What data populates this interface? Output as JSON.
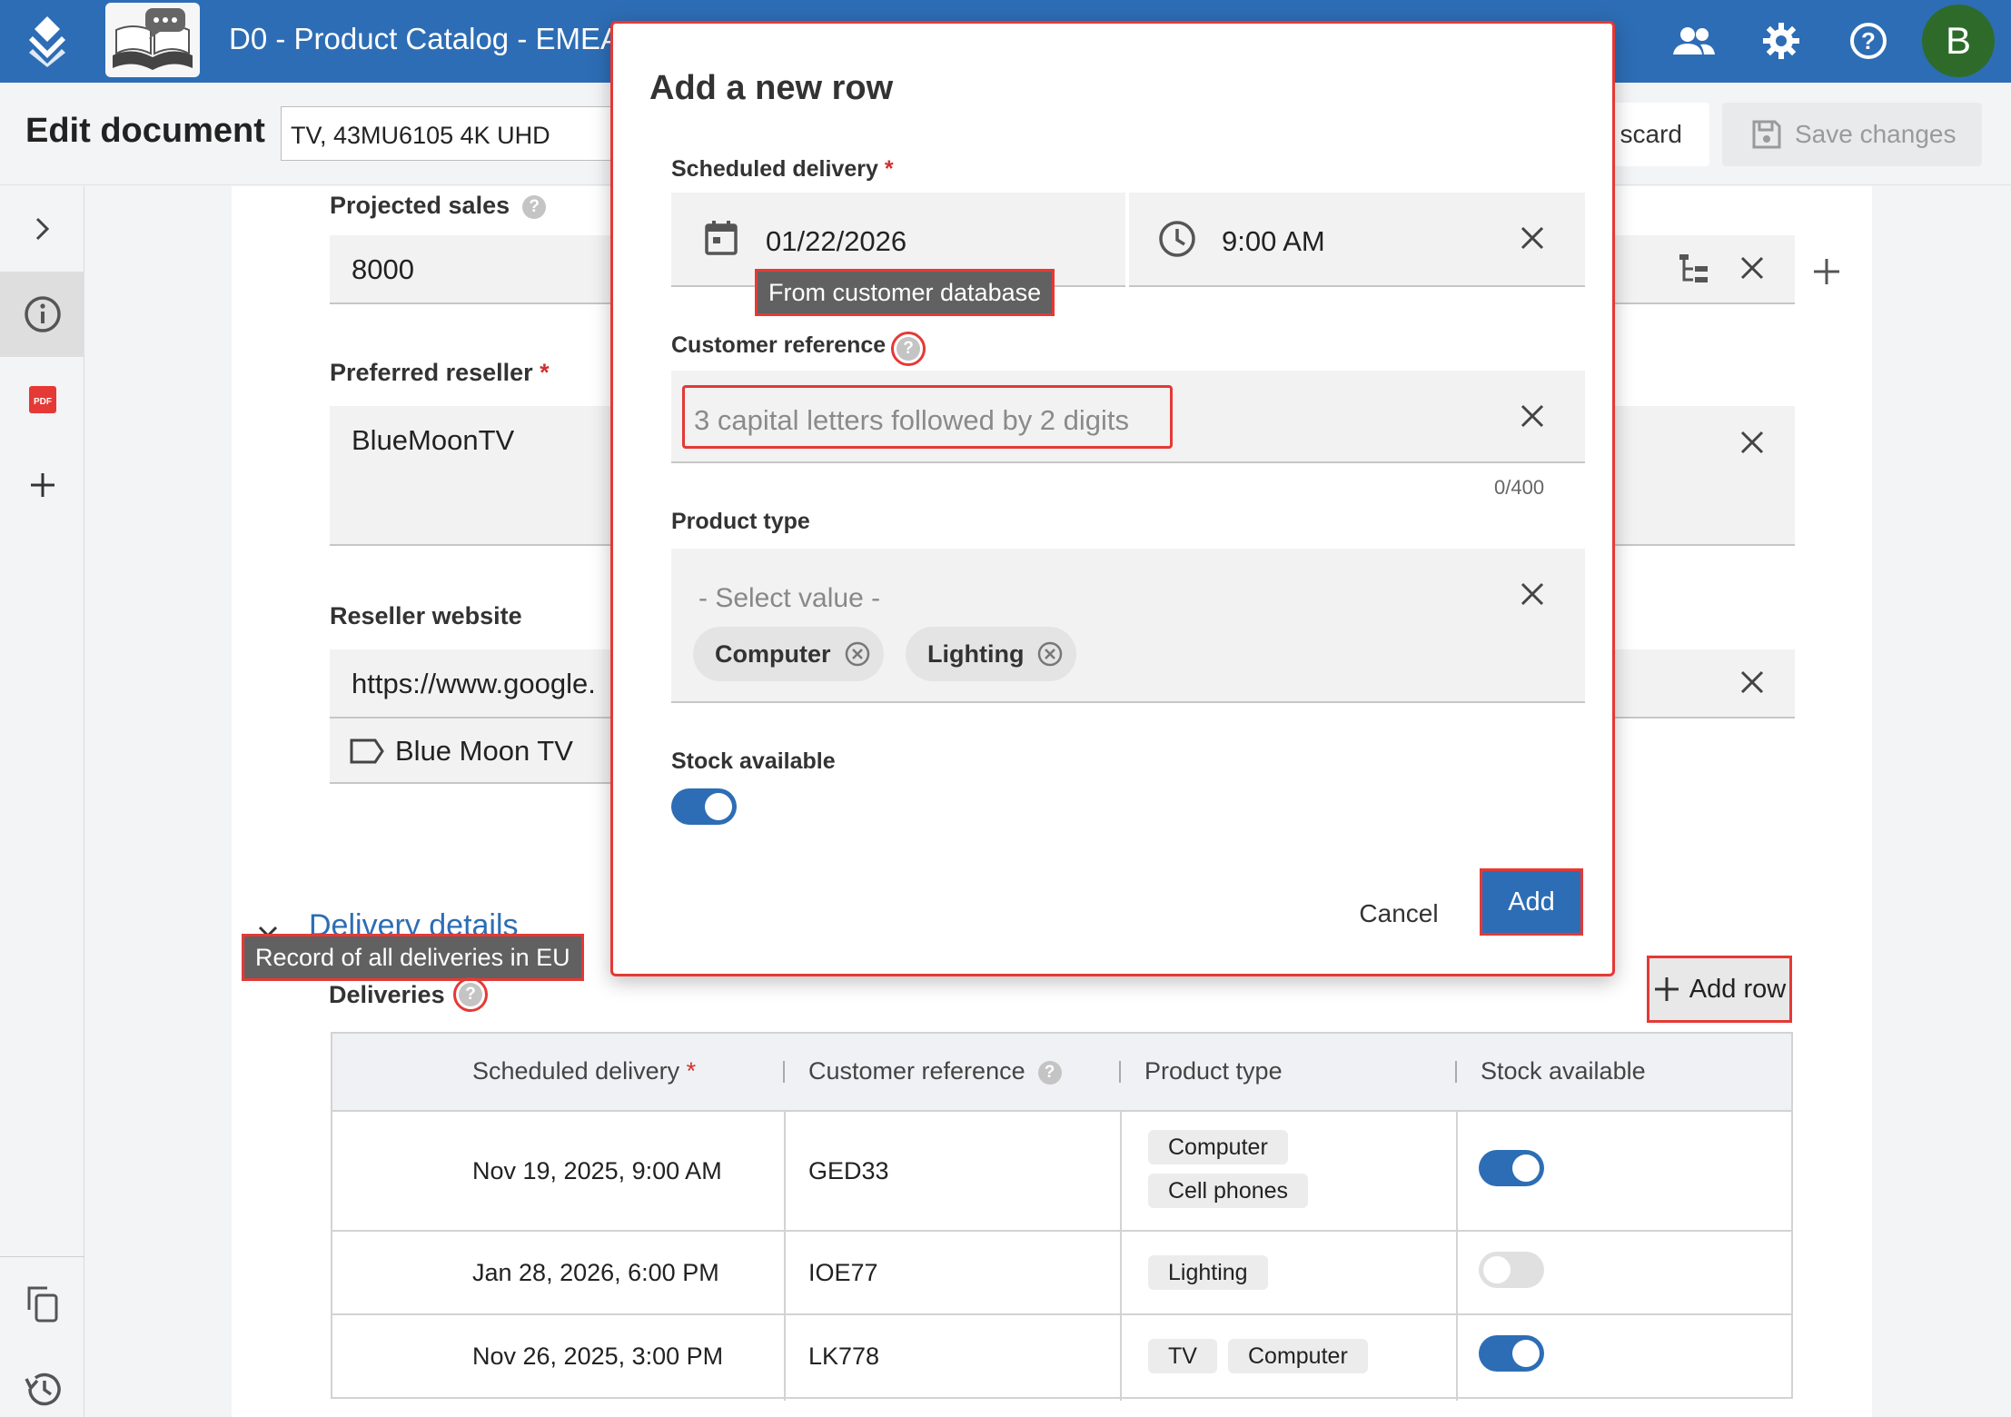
{
  "app": {
    "title": "D0 - Product Catalog - EMEA",
    "avatar_letter": "B",
    "brand_color": "#2d6db5"
  },
  "header": {
    "page_title": "Edit document",
    "document_name": "TV, 43MU6105 4K UHD",
    "discard_label": "scard",
    "save_label": "Save changes"
  },
  "rail": {
    "items": [
      "chevron-right-icon",
      "info-icon",
      "pdf-icon",
      "plus-icon",
      "copy-icon",
      "history-icon"
    ]
  },
  "form": {
    "projected_sales": {
      "label": "Projected sales",
      "value": "8000"
    },
    "preferred_reseller": {
      "label": "Preferred reseller",
      "required": "*",
      "value": "BlueMoonTV"
    },
    "reseller_website": {
      "label": "Reseller website",
      "value": "https://www.google.",
      "link_label": "Blue Moon TV"
    },
    "delivery_section": {
      "title": "Delivery details",
      "tooltip": "Record of all deliveries in EU"
    },
    "deliveries": {
      "label": "Deliveries",
      "add_row_label": "Add row"
    }
  },
  "table": {
    "columns": [
      "Scheduled delivery",
      "Customer reference",
      "Product type",
      "Stock available"
    ],
    "required_mark": "*",
    "rows": [
      {
        "date": "Nov 19, 2025, 9:00 AM",
        "ref": "GED33",
        "types": [
          "Computer",
          "Cell phones"
        ],
        "stock": true
      },
      {
        "date": "Jan 28, 2026, 6:00 PM",
        "ref": "IOE77",
        "types": [
          "Lighting"
        ],
        "stock": false
      },
      {
        "date": "Nov 26, 2025, 3:00 PM",
        "ref": "LK778",
        "types": [
          "TV",
          "Computer"
        ],
        "stock": true
      }
    ]
  },
  "dialog": {
    "title": "Add a new row",
    "scheduled_label": "Scheduled delivery",
    "required_mark": "*",
    "date_value": "01/22/2026",
    "time_value": "9:00 AM",
    "date_tooltip": "From customer database",
    "customer_ref_label": "Customer reference",
    "customer_ref_placeholder": "3 capital letters followed by 2 digits",
    "char_count": "0/400",
    "product_type_label": "Product type",
    "product_type_placeholder": "- Select value -",
    "product_chips": [
      "Computer",
      "Lighting"
    ],
    "stock_label": "Stock available",
    "stock_on": true,
    "cancel_label": "Cancel",
    "add_label": "Add"
  }
}
